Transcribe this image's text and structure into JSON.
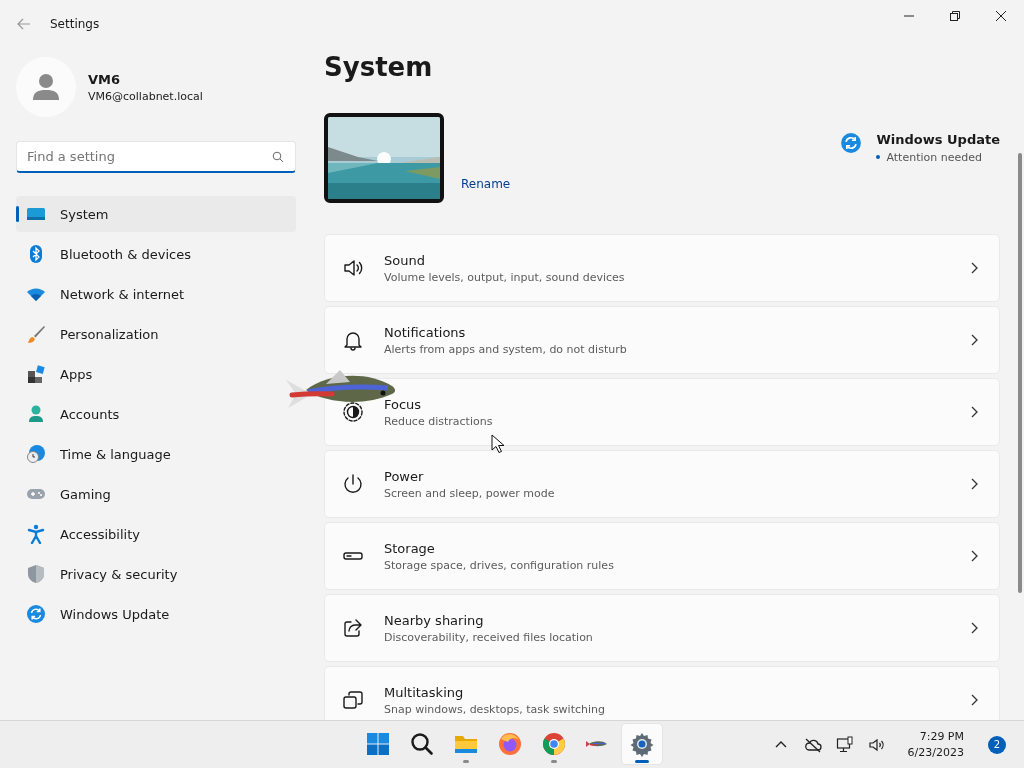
{
  "window": {
    "title": "Settings"
  },
  "user": {
    "name": "VM6",
    "email": "VM6@collabnet.local"
  },
  "search": {
    "placeholder": "Find a setting"
  },
  "sidebar": {
    "items": [
      {
        "label": "System",
        "selected": true
      },
      {
        "label": "Bluetooth & devices",
        "selected": false
      },
      {
        "label": "Network & internet",
        "selected": false
      },
      {
        "label": "Personalization",
        "selected": false
      },
      {
        "label": "Apps",
        "selected": false
      },
      {
        "label": "Accounts",
        "selected": false
      },
      {
        "label": "Time & language",
        "selected": false
      },
      {
        "label": "Gaming",
        "selected": false
      },
      {
        "label": "Accessibility",
        "selected": false
      },
      {
        "label": "Privacy & security",
        "selected": false
      },
      {
        "label": "Windows Update",
        "selected": false
      }
    ]
  },
  "main": {
    "title": "System",
    "device": {
      "kind": "picture",
      "action": "Rename"
    },
    "update": {
      "title": "Windows Update",
      "status": "Attention needed"
    },
    "settings": [
      {
        "title": "Sound",
        "subtitle": "Volume levels, output, input, sound devices"
      },
      {
        "title": "Notifications",
        "subtitle": "Alerts from apps and system, do not disturb"
      },
      {
        "title": "Focus",
        "subtitle": "Reduce distractions"
      },
      {
        "title": "Power",
        "subtitle": "Screen and sleep, power mode"
      },
      {
        "title": "Storage",
        "subtitle": "Storage space, drives, configuration rules"
      },
      {
        "title": "Nearby sharing",
        "subtitle": "Discoverability, received files location"
      },
      {
        "title": "Multitasking",
        "subtitle": "Snap windows, desktops, task switching"
      }
    ]
  },
  "taskbar": {
    "apps": [
      {
        "running": false,
        "active": false
      },
      {
        "running": false,
        "active": false
      },
      {
        "running": true,
        "active": false
      },
      {
        "running": false,
        "active": false
      },
      {
        "running": true,
        "active": false
      },
      {
        "running": false,
        "active": false
      },
      {
        "running": true,
        "active": true
      }
    ],
    "time": "7:29 PM",
    "date": "6/23/2023",
    "notifications": "2"
  }
}
